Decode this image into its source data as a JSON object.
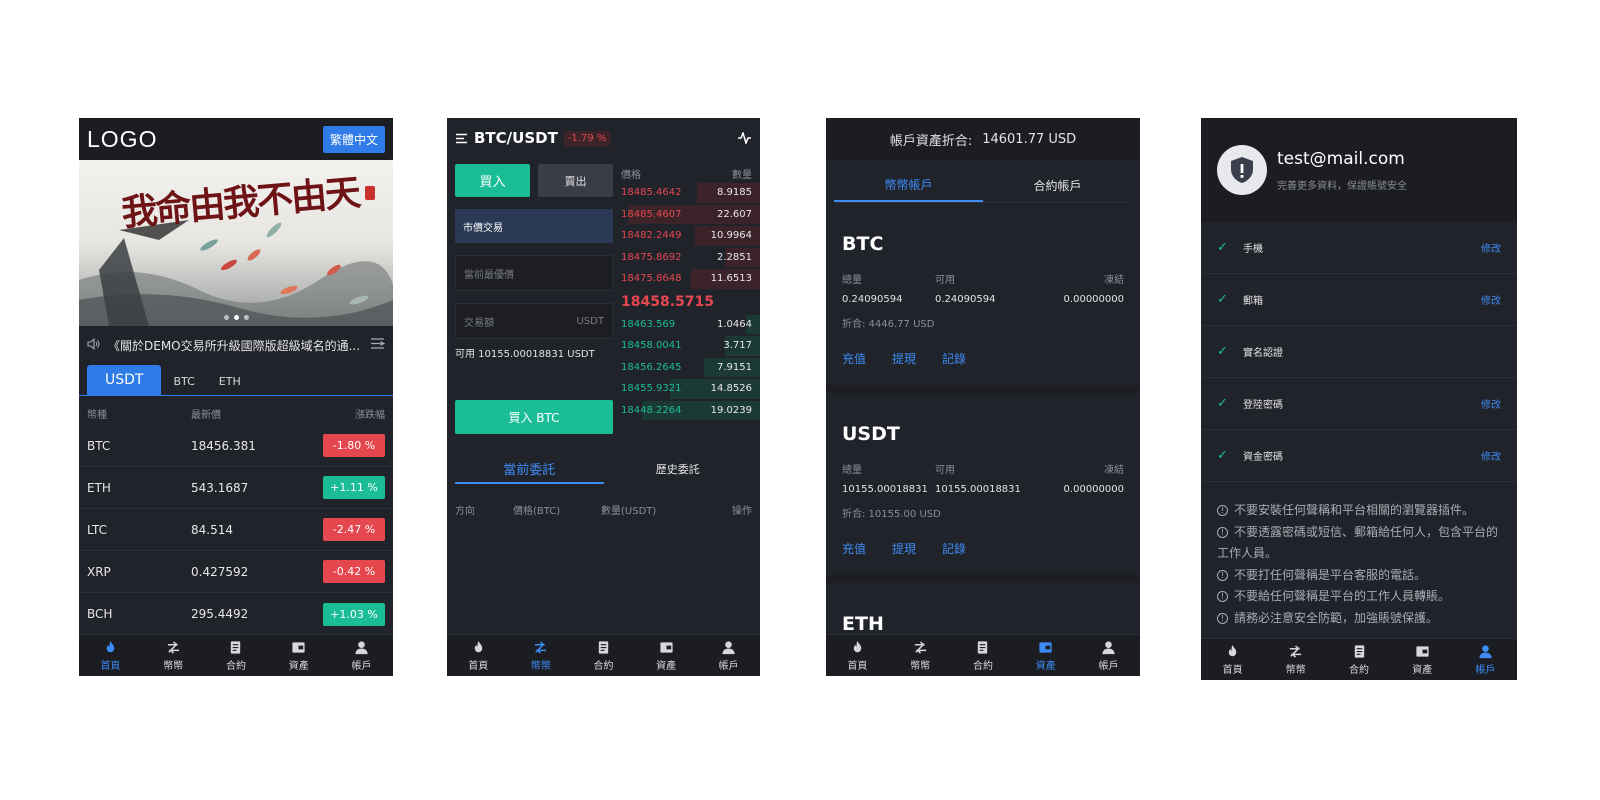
{
  "nav": {
    "home": "首頁",
    "coin": "幣幣",
    "contract": "合約",
    "assets": "資產",
    "account": "帳戶"
  },
  "screen1": {
    "logo": "LOGO",
    "lang_button": "繁體中文",
    "banner_text": "我命由我不由天",
    "notice": "《關於DEMO交易所升級國際版超級域名的通...",
    "tabs": [
      "USDT",
      "BTC",
      "ETH"
    ],
    "headers": {
      "coin": "幣種",
      "price": "最新價",
      "change": "漲跌幅"
    },
    "rows": [
      {
        "coin": "BTC",
        "price": "18456.381",
        "change": "-1.80 %",
        "dir": "down"
      },
      {
        "coin": "ETH",
        "price": "543.1687",
        "change": "+1.11 %",
        "dir": "up"
      },
      {
        "coin": "LTC",
        "price": "84.514",
        "change": "-2.47 %",
        "dir": "down"
      },
      {
        "coin": "XRP",
        "price": "0.427592",
        "change": "-0.42 %",
        "dir": "down"
      },
      {
        "coin": "BCH",
        "price": "295.4492",
        "change": "+1.03 %",
        "dir": "up"
      }
    ]
  },
  "screen2": {
    "pair": "BTC/USDT",
    "change": "-1.79 %",
    "buy": "買入",
    "sell": "賣出",
    "order_type": "市價交易",
    "price_placeholder": "當前最優價",
    "amount_label": "交易額",
    "amount_unit": "USDT",
    "available": "可用 10155.00018831 USDT",
    "buy_button": "買入 BTC",
    "book_headers": {
      "price": "價格",
      "qty": "數量"
    },
    "asks": [
      {
        "price": "18485.4642",
        "qty": "8.9185",
        "depth": 0.45
      },
      {
        "price": "18485.4607",
        "qty": "22.607",
        "depth": 0.95
      },
      {
        "price": "18482.2449",
        "qty": "10.9964",
        "depth": 0.47
      },
      {
        "price": "18475.8692",
        "qty": "2.2851",
        "depth": 0.25
      },
      {
        "price": "18475.8648",
        "qty": "11.6513",
        "depth": 0.5
      }
    ],
    "last_price": "18458.5715",
    "bids": [
      {
        "price": "18463.569",
        "qty": "1.0464",
        "depth": 0.1
      },
      {
        "price": "18458.0041",
        "qty": "3.717",
        "depth": 0.25
      },
      {
        "price": "18456.2645",
        "qty": "7.9151",
        "depth": 0.4
      },
      {
        "price": "18455.9321",
        "qty": "14.8526",
        "depth": 0.65
      },
      {
        "price": "18448.2264",
        "qty": "19.0239",
        "depth": 0.85
      }
    ],
    "order_tabs": [
      "當前委託",
      "歷史委託"
    ],
    "order_headers": [
      "方向",
      "價格(BTC)",
      "數量(USDT)",
      "操作"
    ]
  },
  "screen3": {
    "total_label": "帳戶資產折合:",
    "total_value": "14601.77 USD",
    "tabs": [
      "幣幣帳戶",
      "合約帳戶"
    ],
    "labels": {
      "total": "總量",
      "available": "可用",
      "frozen": "凍結"
    },
    "actions": [
      "充值",
      "提現",
      "記錄"
    ],
    "accounts": [
      {
        "name": "BTC",
        "total": "0.24090594",
        "available": "0.24090594",
        "frozen": "0.00000000",
        "fold": "折合: 4446.77 USD"
      },
      {
        "name": "USDT",
        "total": "10155.00018831",
        "available": "10155.00018831",
        "frozen": "0.00000000",
        "fold": "折合: 10155.00 USD"
      },
      {
        "name": "ETH"
      }
    ]
  },
  "screen4": {
    "email": "test@mail.com",
    "subtitle": "完善更多資料，保證賬號安全",
    "edit": "修改",
    "items": [
      {
        "label": "手機",
        "editable": true
      },
      {
        "label": "郵箱",
        "editable": true
      },
      {
        "label": "實名認證",
        "editable": false
      },
      {
        "label": "登陸密碼",
        "editable": true
      },
      {
        "label": "資金密碼",
        "editable": true
      }
    ],
    "tips": [
      "不要安裝任何聲稱和平台相關的瀏覽器插件。",
      "不要透露密碼或短信、郵箱給任何人，包含平台的工作人員。",
      "不要打任何聲稱是平台客服的電話。",
      "不要給任何聲稱是平台的工作人員轉賬。",
      "請務必注意安全防範，加強賬號保護。"
    ]
  },
  "colors": {
    "accent": "#2f7be8",
    "up": "#1bbd96",
    "down": "#e5474f",
    "bg": "#21232a"
  }
}
